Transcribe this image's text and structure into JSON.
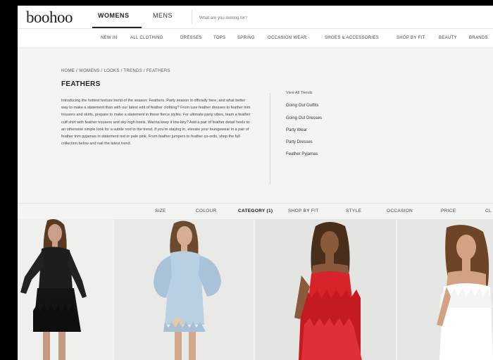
{
  "brand": {
    "logo": "boohoo"
  },
  "header": {
    "tabs": [
      {
        "label": "WOMENS"
      },
      {
        "label": "MENS"
      }
    ],
    "search": {
      "placeholder": "What are you looking for?"
    }
  },
  "nav": {
    "items": [
      {
        "label": "NEW IN"
      },
      {
        "label": "ALL CLOTHING"
      },
      {
        "label": "DRESSES"
      },
      {
        "label": "TOPS"
      },
      {
        "label": "SPRING"
      },
      {
        "label": "OCCASION WEAR"
      },
      {
        "label": "SHOES & ACCESSORIES"
      },
      {
        "label": "SHOP BY FIT"
      },
      {
        "label": "BEAUTY"
      },
      {
        "label": "BRANDS"
      }
    ]
  },
  "breadcrumb": "HOME / WOMENS / LOOKS / TRENDS / FEATHERS",
  "page": {
    "title": "FEATHERS",
    "intro": "Introducing the hottest texture trend of the season: Feathers. Party season is officially here, and what better way to make a statement than with our latest edit of feather clothing? From luxe feather dresses to feather trim trousers and skirts, prepare to make a statement in these fierce styles. For ultimate party vibes, team a feather cuff shirt with feather trousers and sky-high heels. Wanna keep it low-key? Add a pair of feather detail heels to an otherwise simple look for a subtle nod to the trend. If you're staying in, elevate your loungewear in a pair of feather trim pyjamas in statement red or pale pink. From feather jumpers to feather co-ords, shop the full collection below and nail the latest trend."
  },
  "trends": {
    "title": "View All Trends",
    "links": [
      {
        "label": "Going Out Outfits"
      },
      {
        "label": "Going Out Dresses"
      },
      {
        "label": "Party Wear"
      },
      {
        "label": "Party Dresses"
      },
      {
        "label": "Feather Pyjamas"
      }
    ]
  },
  "filters": [
    {
      "label": "SIZE"
    },
    {
      "label": "COLOUR"
    },
    {
      "label": "CATEGORY (1)"
    },
    {
      "label": "SHOP BY FIT"
    },
    {
      "label": "STYLE"
    },
    {
      "label": "OCCASION"
    },
    {
      "label": "PRICE"
    },
    {
      "label": "CL"
    }
  ],
  "colors": {
    "page_background": "#f4f4f3",
    "header_background": "#ffffff",
    "text_primary": "#222222",
    "product_black": "#1a1a1a",
    "product_blue": "#b9cfe2",
    "product_red": "#d8232a",
    "product_white": "#ffffff"
  }
}
